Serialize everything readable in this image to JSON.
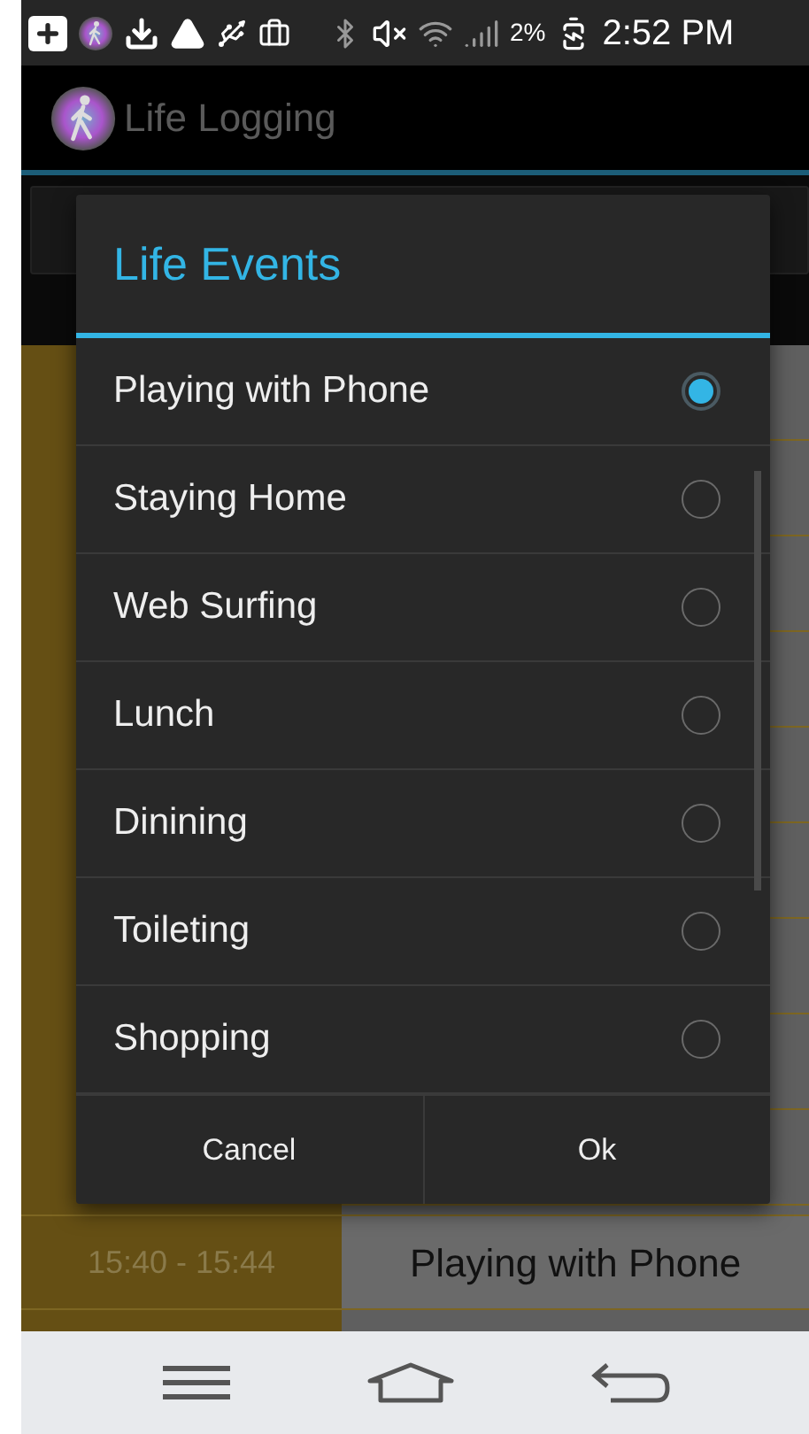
{
  "status_bar": {
    "battery": "2%",
    "time": "2:52 PM"
  },
  "app_bar": {
    "title": "Life Logging"
  },
  "background_list": {
    "rows": [
      {
        "time": "15:40 - 15:44",
        "event": "Playing with Phone"
      }
    ]
  },
  "dialog": {
    "title": "Life Events",
    "options": [
      {
        "label": "Playing with Phone",
        "selected": true
      },
      {
        "label": "Staying Home",
        "selected": false
      },
      {
        "label": "Web Surfing",
        "selected": false
      },
      {
        "label": "Lunch",
        "selected": false
      },
      {
        "label": "Dinining",
        "selected": false
      },
      {
        "label": "Toileting",
        "selected": false
      },
      {
        "label": "Shopping",
        "selected": false
      }
    ],
    "buttons": [
      "Cancel",
      "Ok"
    ]
  }
}
